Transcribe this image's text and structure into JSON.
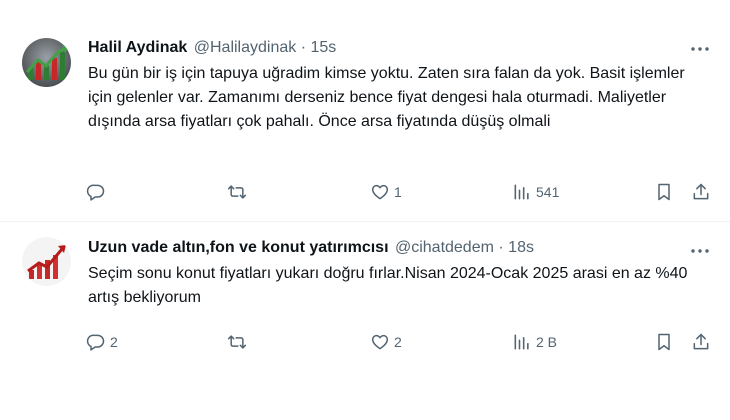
{
  "tweets": [
    {
      "name": "Halil Aydinak",
      "handle": "@Halilaydinak",
      "separator": "·",
      "time": "15s",
      "text": "Bu gün bir iş için tapuya uğradim kimse yoktu. Zaten sıra falan da yok. Basit işlemler için gelenler var. Zamanımı derseniz bence fiyat dengesi hala oturmadi. Maliyetler dışında arsa fiyatları çok pahalı. Önce arsa fiyatında düşüş olmali",
      "reply_count": "",
      "repost_count": "",
      "like_count": "1",
      "view_count": "541"
    },
    {
      "name": "Uzun vade altın,fon ve konut yatırımcısı",
      "handle": "@cihatdedem",
      "separator": "·",
      "time": "18s",
      "text": "Seçim sonu konut fiyatları yukarı doğru fırlar.Nisan 2024-Ocak 2025 arasi en az %40 artış bekliyorum",
      "reply_count": "2",
      "repost_count": "",
      "like_count": "2",
      "view_count": "2 B"
    }
  ],
  "icons": {
    "more": "more-horizontal-icon",
    "reply": "reply-icon",
    "repost": "repost-icon",
    "like": "heart-icon",
    "views": "views-chart-icon",
    "bookmark": "bookmark-icon",
    "share": "share-icon"
  },
  "colors": {
    "text_primary": "#0f1419",
    "text_secondary": "#536471",
    "divider": "#eff3f4"
  }
}
